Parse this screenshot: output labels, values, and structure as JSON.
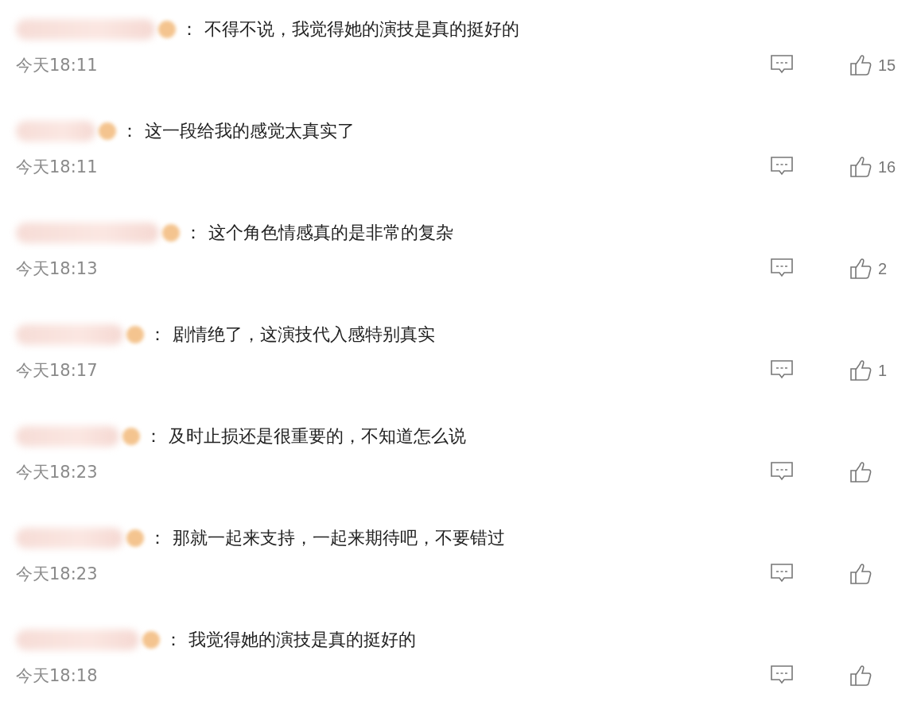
{
  "comments": [
    {
      "separator": "：",
      "text": "不得不说，我觉得她的演技是真的挺好的",
      "time": "今天18:11",
      "likes": "15"
    },
    {
      "separator": "：",
      "text": "这一段给我的感觉太真实了",
      "time": "今天18:11",
      "likes": "16"
    },
    {
      "separator": "：",
      "text": "这个角色情感真的是非常的复杂",
      "time": "今天18:13",
      "likes": "2"
    },
    {
      "separator": "：",
      "text": "剧情绝了，这演技代入感特别真实",
      "time": "今天18:17",
      "likes": "1"
    },
    {
      "separator": "：",
      "text": "及时止损还是很重要的，不知道怎么说",
      "time": "今天18:23"
    },
    {
      "separator": "：",
      "text": "那就一起来支持，一起来期待吧，不要错过",
      "time": "今天18:23"
    },
    {
      "separator": "：",
      "text": "我觉得她的演技是真的挺好的",
      "time": "今天18:18"
    }
  ]
}
